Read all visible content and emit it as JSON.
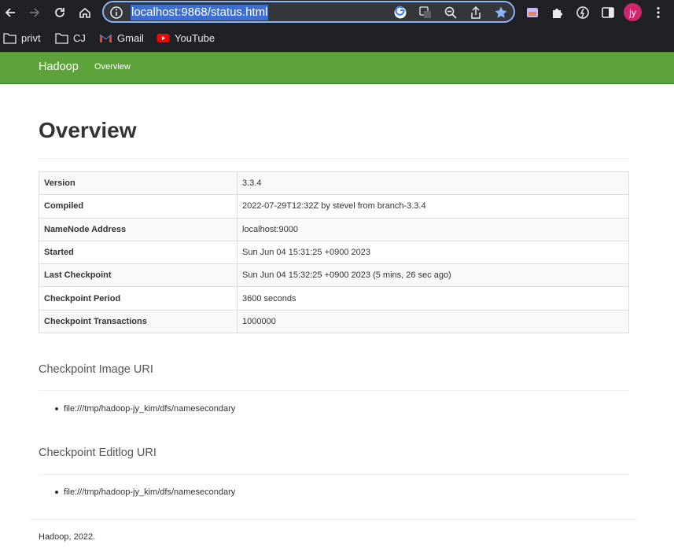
{
  "browser": {
    "url": "localhost:9868/status.html",
    "avatar_initials": "jy",
    "accent_color": "#8ab4f8",
    "bookmarks": [
      "privt",
      "CJ",
      "Gmail",
      "YouTube"
    ]
  },
  "navbar": {
    "brand": "Hadoop",
    "link": "Overview",
    "color": "#5ea23b"
  },
  "page": {
    "title": "Overview",
    "rows": [
      {
        "key": "Version",
        "value": "3.3.4"
      },
      {
        "key": "Compiled",
        "value": "2022-07-29T12:32Z by stevel from branch-3.3.4"
      },
      {
        "key": "NameNode Address",
        "value": "localhost:9000"
      },
      {
        "key": "Started",
        "value": "Sun Jun 04 15:31:25 +0900 2023"
      },
      {
        "key": "Last Checkpoint",
        "value": "Sun Jun 04 15:32:25 +0900 2023 (5 mins, 26 sec ago)"
      },
      {
        "key": "Checkpoint Period",
        "value": "3600 seconds"
      },
      {
        "key": "Checkpoint Transactions",
        "value": "1000000"
      }
    ],
    "image_uri_title": "Checkpoint Image URI",
    "image_uri": "file:///tmp/hadoop-jy_kim/dfs/namesecondary",
    "editlog_uri_title": "Checkpoint Editlog URI",
    "editlog_uri": "file:///tmp/hadoop-jy_kim/dfs/namesecondary",
    "footer": "Hadoop, 2022."
  }
}
